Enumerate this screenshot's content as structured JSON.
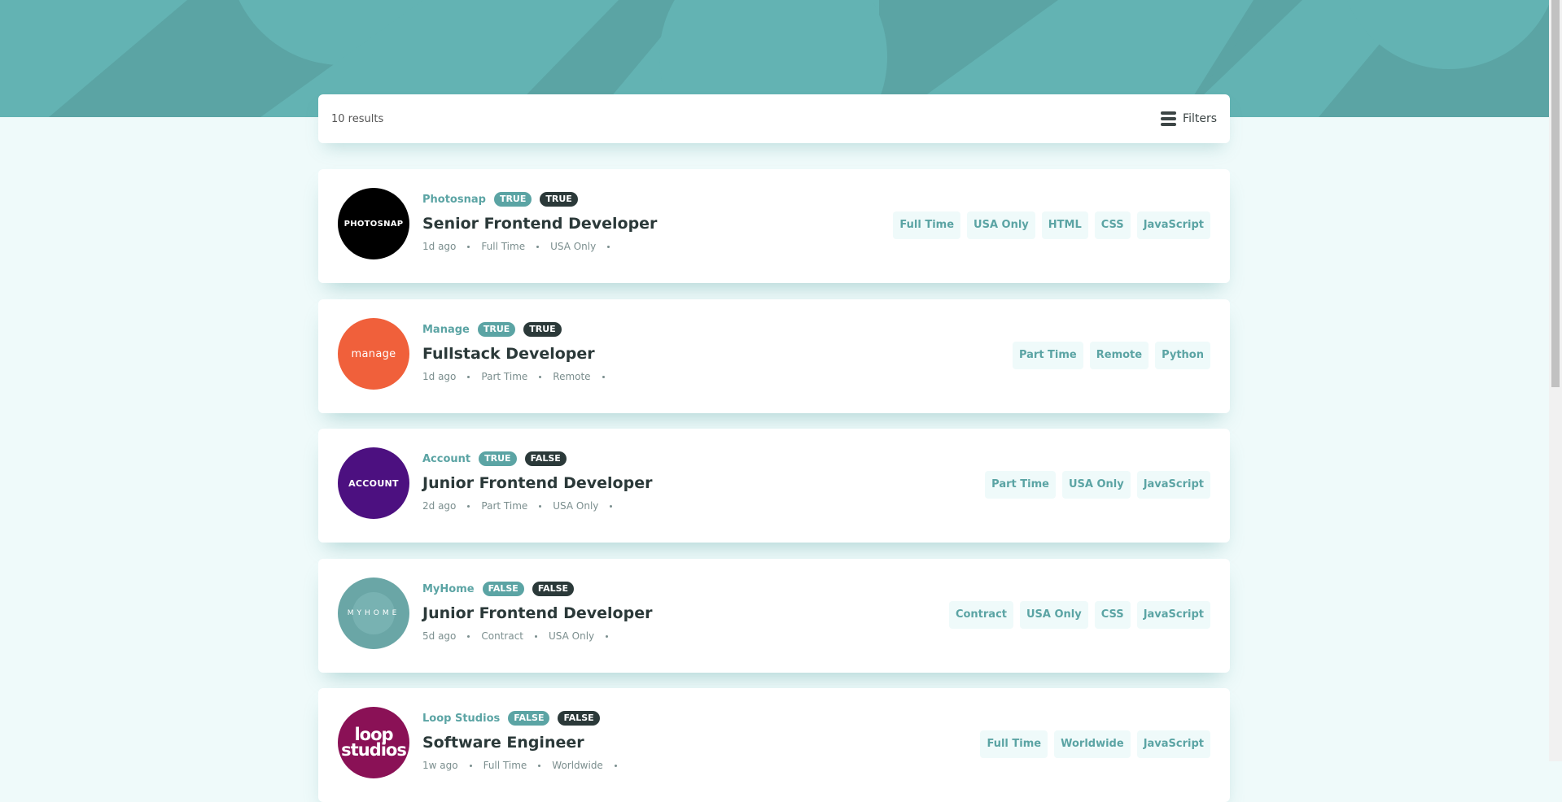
{
  "header": {
    "results_label": "10 results",
    "filters_label": "Filters"
  },
  "colors": {
    "primary": "#5ba4a4",
    "dark": "#2b3939",
    "background": "#effafa"
  },
  "jobs": [
    {
      "company": "Photosnap",
      "new_label": "TRUE",
      "featured_label": "TRUE",
      "position": "Senior Frontend Developer",
      "posted": "1d ago",
      "contract": "Full Time",
      "location": "USA Only",
      "logo": {
        "text": "PHOTOSNAP",
        "color": "#000000"
      },
      "tags": [
        "Full Time",
        "USA Only",
        "HTML",
        "CSS",
        "JavaScript"
      ]
    },
    {
      "company": "Manage",
      "new_label": "TRUE",
      "featured_label": "TRUE",
      "position": "Fullstack Developer",
      "posted": "1d ago",
      "contract": "Part Time",
      "location": "Remote",
      "logo": {
        "text": "manage",
        "color": "#f0603b"
      },
      "tags": [
        "Part Time",
        "Remote",
        "Python"
      ]
    },
    {
      "company": "Account",
      "new_label": "TRUE",
      "featured_label": "FALSE",
      "position": "Junior Frontend Developer",
      "posted": "2d ago",
      "contract": "Part Time",
      "location": "USA Only",
      "logo": {
        "text": "ACCOUNT",
        "color": "#4c1080"
      },
      "tags": [
        "Part Time",
        "USA Only",
        "JavaScript"
      ]
    },
    {
      "company": "MyHome",
      "new_label": "FALSE",
      "featured_label": "FALSE",
      "position": "Junior Frontend Developer",
      "posted": "5d ago",
      "contract": "Contract",
      "location": "USA Only",
      "logo": {
        "text": "MYHOME",
        "color": "#6aa6a6"
      },
      "tags": [
        "Contract",
        "USA Only",
        "CSS",
        "JavaScript"
      ]
    },
    {
      "company": "Loop Studios",
      "new_label": "FALSE",
      "featured_label": "FALSE",
      "position": "Software Engineer",
      "posted": "1w ago",
      "contract": "Full Time",
      "location": "Worldwide",
      "logo": {
        "text": "loop studios",
        "color": "#8a1156"
      },
      "tags": [
        "Full Time",
        "Worldwide",
        "JavaScript"
      ]
    }
  ]
}
